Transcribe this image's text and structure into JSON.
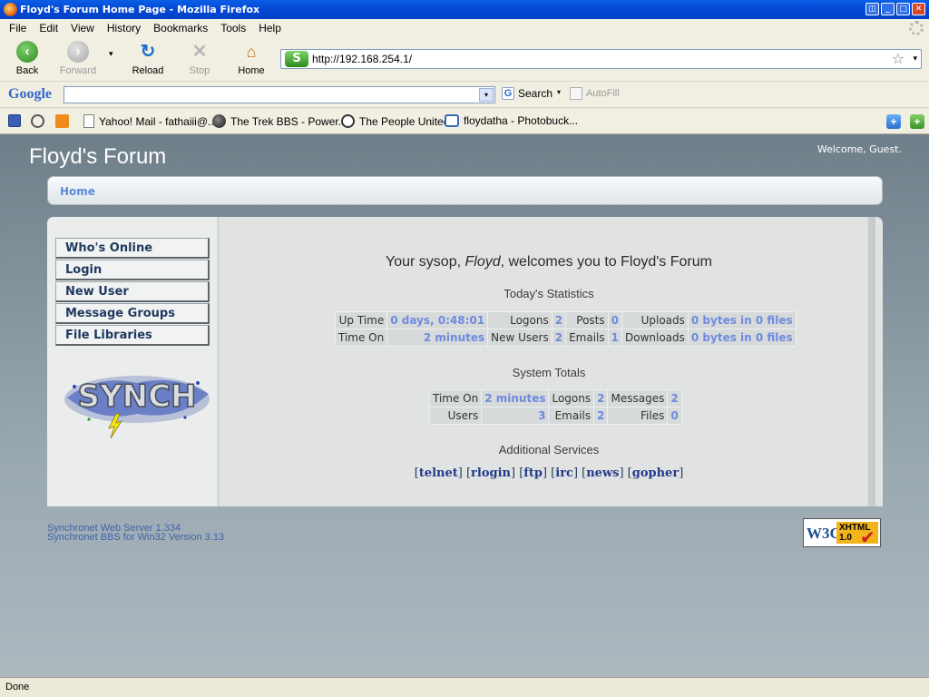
{
  "window": {
    "title": "Floyd's Forum Home Page - Mozilla Firefox"
  },
  "menu": {
    "items": [
      "File",
      "Edit",
      "View",
      "History",
      "Bookmarks",
      "Tools",
      "Help"
    ]
  },
  "nav": {
    "back": "Back",
    "forward": "Forward",
    "reload": "Reload",
    "stop": "Stop",
    "home": "Home",
    "url": "http://192.168.254.1/"
  },
  "google_toolbar": {
    "logo": "Google",
    "search_value": "",
    "search_label": "Search",
    "autofill": "AutoFill"
  },
  "bookmarks": {
    "items": [
      "Yahoo! Mail - fathaiii@...",
      "The Trek BBS - Power...",
      "The People United",
      "floydatha - Photobuck..."
    ]
  },
  "page": {
    "site_title": "Floyd's Forum",
    "welcome": "Welcome, Guest.",
    "breadcrumb": "Home",
    "sidebar": [
      "Who's Online",
      "Login",
      "New User",
      "Message Groups",
      "File Libraries"
    ],
    "logo_text": "SYNCH",
    "headline": {
      "pre": "Your sysop, ",
      "name": "Floyd",
      "post": ", welcomes you to Floyd's Forum"
    },
    "todays_title": "Today's Statistics",
    "todays": {
      "row1": [
        "Up Time",
        "0 days, 0:48:01",
        "Logons",
        "2",
        "Posts",
        "0",
        "Uploads",
        "0 bytes in 0 files"
      ],
      "row2": [
        "Time On",
        "2 minutes",
        "New Users",
        "2",
        "Emails",
        "1",
        "Downloads",
        "0 bytes in 0 files"
      ]
    },
    "totals_title": "System Totals",
    "totals": {
      "row1": [
        "Time On",
        "2 minutes",
        "Logons",
        "2",
        "Messages",
        "2"
      ],
      "row2": [
        "Users",
        "3",
        "Emails",
        "2",
        "Files",
        "0"
      ]
    },
    "services_title": "Additional Services",
    "services": [
      "telnet",
      "rlogin",
      "ftp",
      "irc",
      "news",
      "gopher"
    ],
    "footer": [
      "Synchronet Web Server 1.334",
      "Synchronet BBS for Win32 Version 3.13"
    ],
    "badge": {
      "w3c": "W3C",
      "xhtml": "XHTML",
      "version": "1.0"
    }
  },
  "status": {
    "text": "Done"
  }
}
